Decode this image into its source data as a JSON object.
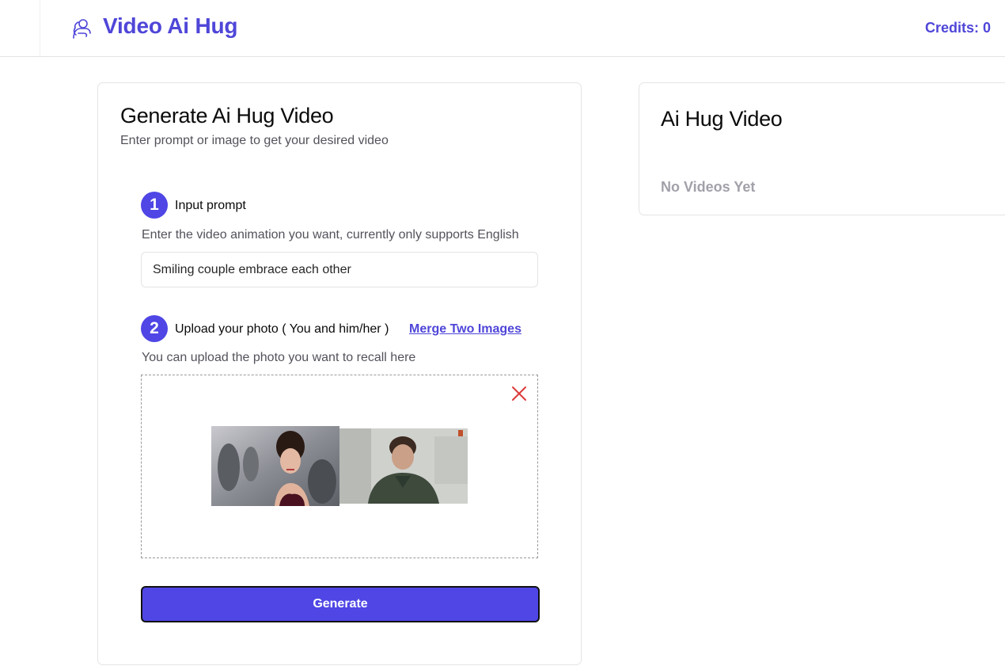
{
  "header": {
    "app_title": "Video Ai Hug",
    "logo_icon": "hug-icon",
    "credits": "Credits: 0"
  },
  "generator": {
    "title": "Generate Ai Hug Video",
    "subtitle": "Enter prompt or image to get your desired video",
    "step1": {
      "number": "1",
      "label": "Input prompt",
      "helper": "Enter the video animation you want, currently only supports English",
      "input_value": "Smiling couple embrace each other"
    },
    "step2": {
      "number": "2",
      "label": "Upload your photo ( You and him/her )",
      "link": "Merge Two Images",
      "helper": "You can upload the photo you want to recall here"
    },
    "generate_label": "Generate"
  },
  "result": {
    "title": "Ai Hug Video",
    "empty_text": "No Videos Yet"
  },
  "colors": {
    "accent": "#4f46e5",
    "brand_text": "#4f46d8",
    "remove": "#dc3b3b",
    "muted": "#a1a1aa"
  }
}
